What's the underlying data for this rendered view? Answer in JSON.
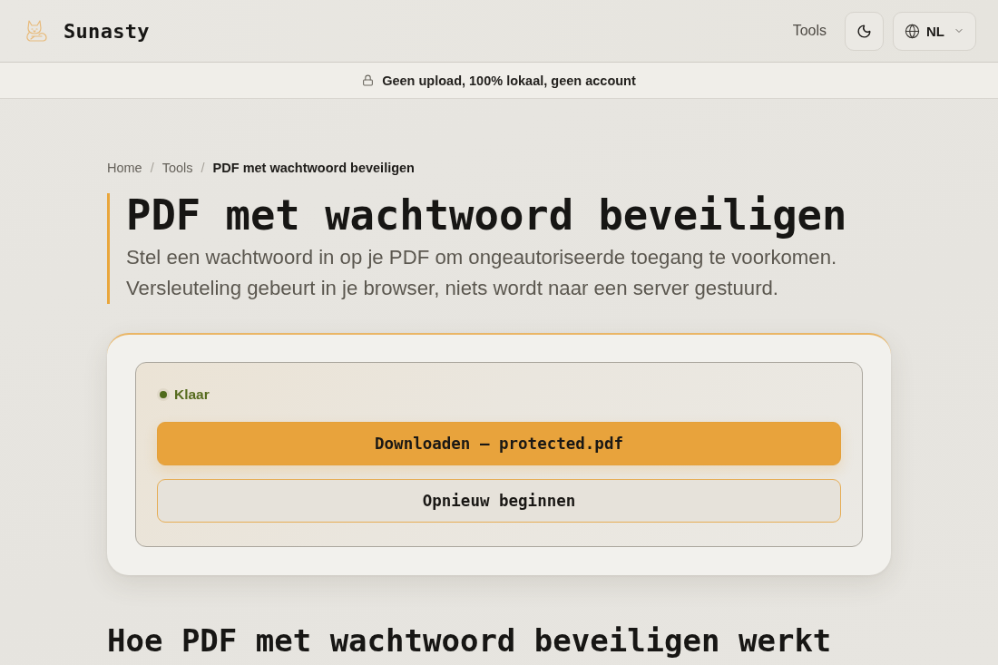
{
  "header": {
    "logo": "Sunasty",
    "nav": [
      {
        "label": "Tools"
      }
    ],
    "language": "NL"
  },
  "banner": {
    "text": "Geen upload, 100% lokaal, geen account"
  },
  "breadcrumb": {
    "items": [
      {
        "label": "Home",
        "current": false
      },
      {
        "label": "Tools",
        "current": false
      },
      {
        "label": "PDF met wachtwoord beveiligen",
        "current": true
      }
    ],
    "separators": [
      "/",
      "/"
    ]
  },
  "intro": {
    "title": "PDF met wachtwoord beveiligen",
    "description_lines": [
      "Stel een wachtwoord in op je PDF om ongeautoriseerde toegang te voorkomen.",
      "Versleuteling gebeurt in je browser, niets wordt naar een server gestuurd."
    ]
  },
  "result": {
    "status": {
      "label": "Klaar",
      "ready": true
    },
    "actions": [
      {
        "label": "Downloaden — protected.pdf",
        "kind": "primary"
      },
      {
        "label": "Opnieuw beginnen",
        "kind": "secondary"
      }
    ]
  },
  "section": {
    "heading": "Hoe PDF met wachtwoord beveiligen werkt"
  }
}
